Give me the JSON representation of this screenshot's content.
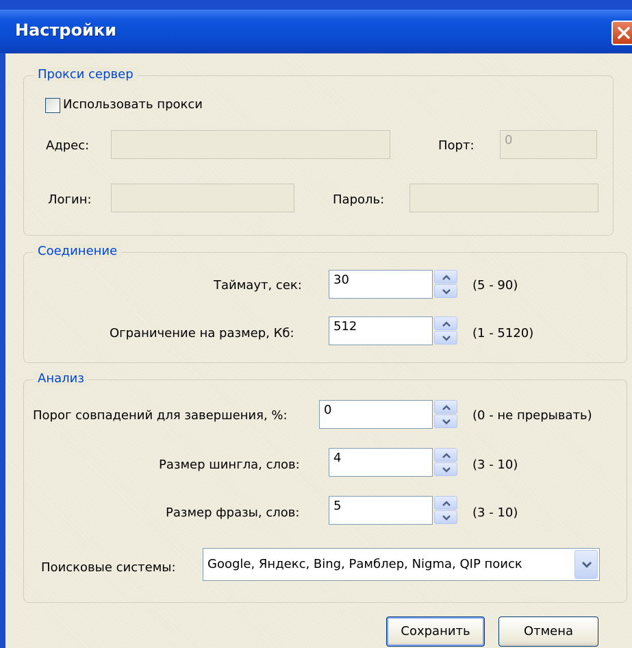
{
  "window": {
    "title": "Настройки"
  },
  "proxy": {
    "group_title": "Прокси сервер",
    "use_proxy_label": "Использовать прокси",
    "use_proxy_checked": false,
    "address_label": "Адрес:",
    "address_value": "",
    "port_label": "Порт:",
    "port_value": "0",
    "login_label": "Логин:",
    "login_value": "",
    "password_label": "Пароль:",
    "password_value": ""
  },
  "connection": {
    "group_title": "Соединение",
    "timeout_label": "Таймаут, сек:",
    "timeout_value": "30",
    "timeout_range": "(5 - 90)",
    "size_label": "Ограничение на размер, Кб:",
    "size_value": "512",
    "size_range": "(1 - 5120)"
  },
  "analysis": {
    "group_title": "Анализ",
    "threshold_label": "Порог совпадений для завершения, %:",
    "threshold_value": "0",
    "threshold_range": "(0 - не прерывать)",
    "shingle_label": "Размер шингла, слов:",
    "shingle_value": "4",
    "shingle_range": "(3 - 10)",
    "phrase_label": "Размер фразы, слов:",
    "phrase_value": "5",
    "phrase_range": "(3 - 10)",
    "search_label": "Поисковые системы:",
    "search_value": "Google, Яндекс, Bing, Рамблер, Nigma, QIP поиск"
  },
  "buttons": {
    "save": "Сохранить",
    "cancel": "Отмена"
  },
  "colors": {
    "title_bar": "#0a4ad0",
    "group_title": "#0046d5",
    "dialog_bg": "#ece9d8",
    "close_button": "#c5401a"
  }
}
